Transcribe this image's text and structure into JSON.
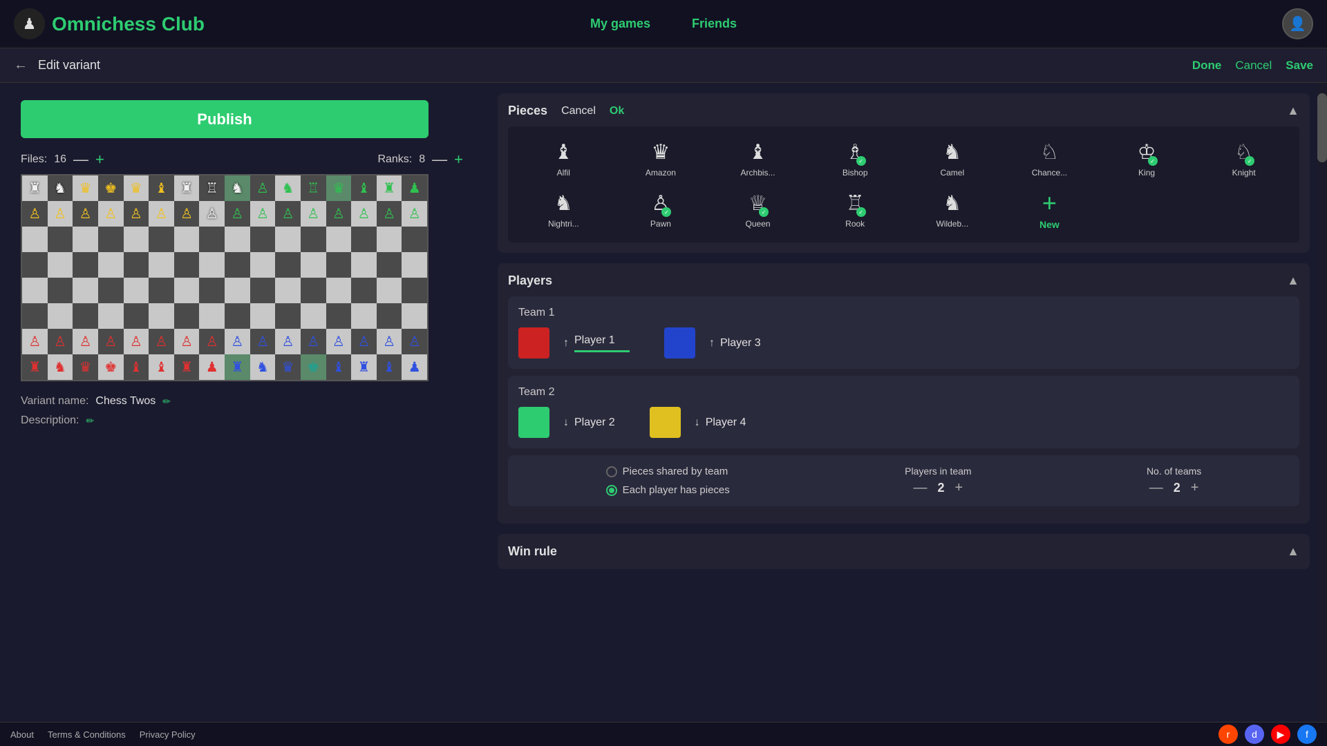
{
  "app": {
    "logo_text": "Omnichess Club",
    "logo_icon": "♟",
    "nav": {
      "my_games": "My games",
      "friends": "Friends"
    }
  },
  "subheader": {
    "back_icon": "←",
    "title": "Edit variant",
    "done": "Done",
    "cancel": "Cancel",
    "save": "Save"
  },
  "left_panel": {
    "publish_button": "Publish",
    "files_label": "Files:",
    "files_value": "16",
    "ranks_label": "Ranks:",
    "ranks_value": "8",
    "variant_name_label": "Variant name:",
    "variant_name_value": "Chess Twos",
    "description_label": "Description:"
  },
  "pieces_section": {
    "title": "Pieces",
    "cancel_label": "Cancel",
    "ok_label": "Ok",
    "items": [
      {
        "name": "Alfil",
        "icon": "♝",
        "checked": false
      },
      {
        "name": "Amazon",
        "icon": "♛",
        "checked": false
      },
      {
        "name": "Archbis...",
        "icon": "♝",
        "checked": false
      },
      {
        "name": "Bishop",
        "icon": "♗",
        "checked": true
      },
      {
        "name": "Camel",
        "icon": "♞",
        "checked": false
      },
      {
        "name": "Chance...",
        "icon": "♘",
        "checked": false
      },
      {
        "name": "King",
        "icon": "♔",
        "checked": true
      },
      {
        "name": "Knight",
        "icon": "♘",
        "checked": true
      },
      {
        "name": "Nightri...",
        "icon": "♞",
        "checked": false
      },
      {
        "name": "Pawn",
        "icon": "♙",
        "checked": true
      },
      {
        "name": "Queen",
        "icon": "♕",
        "checked": true
      },
      {
        "name": "Rook",
        "icon": "♖",
        "checked": true
      },
      {
        "name": "Wildeb...",
        "icon": "♞",
        "checked": false
      },
      {
        "name": "New",
        "icon": "+",
        "checked": false
      }
    ]
  },
  "players_section": {
    "title": "Players",
    "team1": {
      "label": "Team 1",
      "player1": {
        "name": "Player 1",
        "color": "#cc2222",
        "direction": "↑"
      },
      "player3": {
        "name": "Player 3",
        "color": "#2244cc",
        "direction": "↑"
      }
    },
    "team2": {
      "label": "Team 2",
      "player2": {
        "name": "Player 2",
        "color": "#2ecc71",
        "direction": "↓"
      },
      "player4": {
        "name": "Player 4",
        "color": "#e0c020",
        "direction": "↓"
      }
    }
  },
  "options": {
    "pieces_shared": "Pieces shared by team",
    "each_player": "Each player has pieces",
    "players_in_team_label": "Players in team",
    "players_in_team_value": "2",
    "no_of_teams_label": "No. of teams",
    "no_of_teams_value": "2"
  },
  "win_rule": {
    "title": "Win rule"
  },
  "footer": {
    "about": "About",
    "terms": "Terms & Conditions",
    "privacy": "Privacy Policy"
  },
  "socials": {
    "reddit": "r",
    "discord": "d",
    "youtube": "▶",
    "facebook": "f"
  }
}
